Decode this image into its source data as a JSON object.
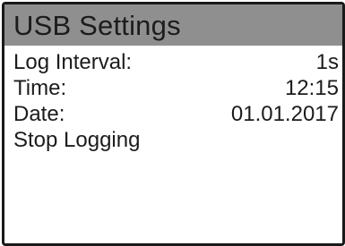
{
  "screen": {
    "title": "USB Settings",
    "menu": [
      {
        "label": "Log Interval:",
        "value": "1s"
      },
      {
        "label": "Time:",
        "value": "12:15"
      },
      {
        "label": "Date:",
        "value": "01.01.2017"
      },
      {
        "label": "Stop Logging",
        "value": ""
      }
    ]
  },
  "colors": {
    "title_bar_bg": "#8f8f8f",
    "text": "#1c1c1c",
    "screen_bg": "#ffffff",
    "border": "#1a1a1a"
  }
}
